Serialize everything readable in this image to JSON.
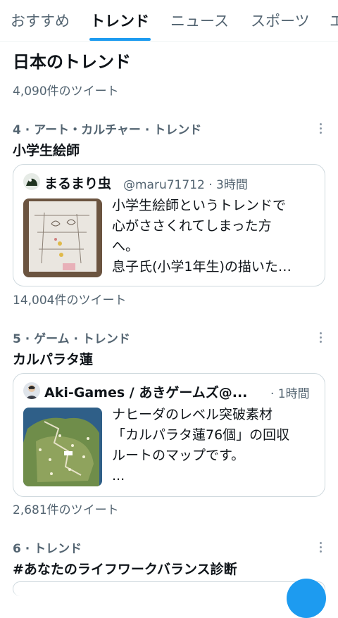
{
  "tabs": [
    {
      "label": "おすすめ",
      "active": false
    },
    {
      "label": "トレンド",
      "active": true
    },
    {
      "label": "ニュース",
      "active": false
    },
    {
      "label": "スポーツ",
      "active": false
    },
    {
      "label": "エ",
      "active": false
    }
  ],
  "section": {
    "title": "日本のトレンド",
    "count": "4,090件のツイート"
  },
  "trends": [
    {
      "meta": "4 · アート・カルチャー · トレンド",
      "topic": "小学生絵師",
      "tweet": {
        "author": "まるまり虫",
        "handle": "@maru71712 · 3時間",
        "text": [
          "小学生絵師というトレンドで",
          "心がささくれてしまった方",
          "へ。",
          "息子氏(小学1年生)の描いた…"
        ]
      },
      "count": "14,004件のツイート"
    },
    {
      "meta": "5 · ゲーム · トレンド",
      "topic": "カルパラタ蓮",
      "tweet": {
        "author": "Aki-Games / あきゲームズ@...",
        "handle": "· 1時間",
        "text": [
          "ナヒーダのレベル突破素材",
          "「カルパラタ蓮76個」の回収",
          "ルートのマップです。",
          "..."
        ]
      },
      "count": "2,681件のツイート"
    },
    {
      "meta": "6 · トレンド",
      "topic": "#あなたのライフワークバランス診断"
    }
  ],
  "colors": {
    "accent": "#1d9bf0",
    "secondary_text": "#536471",
    "border": "#cfd9de"
  },
  "icons": {
    "more": "more-vertical-icon",
    "compose": "compose-fab"
  }
}
